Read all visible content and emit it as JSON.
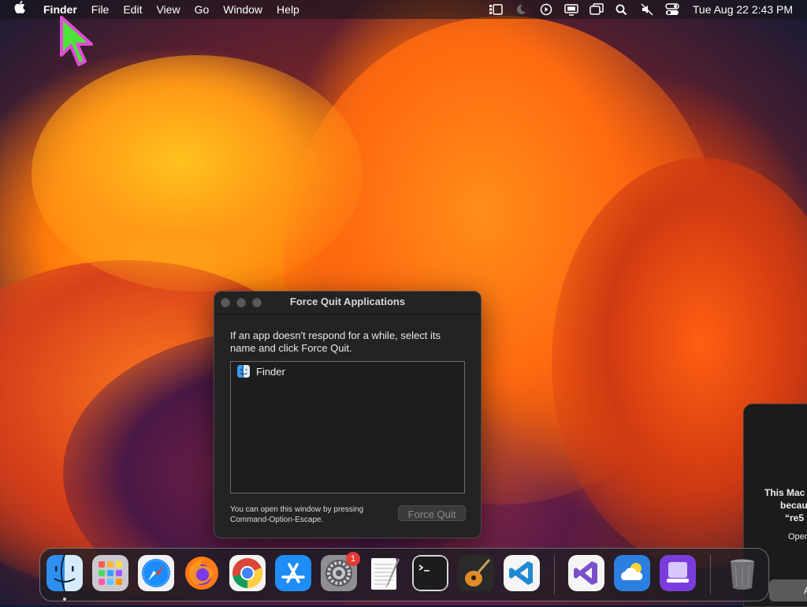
{
  "menubar": {
    "apple_icon": "apple-icon",
    "items": [
      "Finder",
      "File",
      "Edit",
      "View",
      "Go",
      "Window",
      "Help"
    ],
    "status_icons": [
      "stage-manager-icon",
      "focus-moon-icon",
      "screen-recording-icon",
      "display-icon",
      "screen-mirroring-icon",
      "spotlight-search-icon",
      "mute-icon",
      "control-center-icon"
    ],
    "clock": "Tue Aug 22  2:43 PM"
  },
  "dialog": {
    "title": "Force Quit Applications",
    "description": "If an app doesn't respond for a while, select its name and click Force Quit.",
    "apps": [
      {
        "name": "Finder",
        "icon": "finder-icon"
      }
    ],
    "hint": "You can open this window by pressing Command-Option-Escape.",
    "force_quit_label": "Force Quit"
  },
  "notification": {
    "line1": "This Mac",
    "line2": "becau",
    "line3": "“re5",
    "sub": "Open",
    "button": "A"
  },
  "dock": {
    "apps": [
      {
        "name": "Finder",
        "icon": "finder-icon",
        "running": true
      },
      {
        "name": "Launchpad",
        "icon": "launchpad-icon"
      },
      {
        "name": "Safari",
        "icon": "safari-icon"
      },
      {
        "name": "Firefox",
        "icon": "firefox-icon"
      },
      {
        "name": "Chrome",
        "icon": "chrome-icon"
      },
      {
        "name": "App Store",
        "icon": "app-store-icon"
      },
      {
        "name": "System Settings",
        "icon": "system-settings-icon",
        "badge": "1"
      },
      {
        "name": "TextEdit",
        "icon": "textedit-icon"
      },
      {
        "name": "Terminal",
        "icon": "terminal-icon"
      },
      {
        "name": "GarageBand",
        "icon": "garageband-icon"
      },
      {
        "name": "Visual Studio Code",
        "icon": "vscode-icon"
      },
      {
        "name": "Visual Studio",
        "icon": "visual-studio-icon"
      },
      {
        "name": "Weather",
        "icon": "weather-icon"
      },
      {
        "name": "Apple Configurator",
        "icon": "apple-configurator-icon"
      },
      {
        "name": "Trash",
        "icon": "trash-icon"
      }
    ]
  }
}
